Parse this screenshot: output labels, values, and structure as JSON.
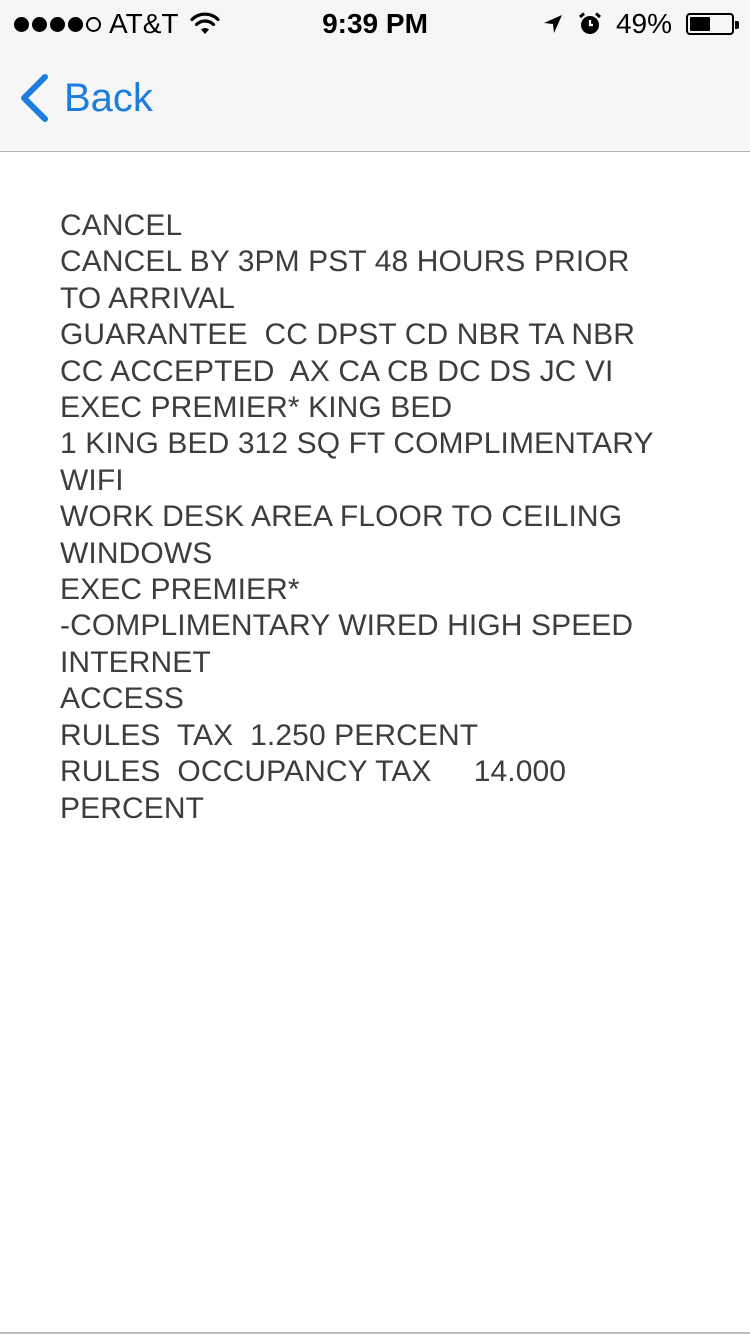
{
  "status_bar": {
    "carrier": "AT&T",
    "time": "9:39 PM",
    "battery_text": "49%",
    "battery_level": 0.49,
    "signal_dots_filled": 4,
    "signal_dots_total": 5,
    "icons": [
      "wifi-icon",
      "location-arrow-icon",
      "alarm-icon",
      "battery-icon"
    ]
  },
  "nav": {
    "back_label": "Back",
    "accent_color": "#1b7dde"
  },
  "details": {
    "lines": [
      "CANCEL",
      "CANCEL BY 3PM PST 48 HOURS PRIOR",
      "TO ARRIVAL",
      "GUARANTEE  CC DPST CD NBR TA NBR",
      "CC ACCEPTED  AX CA CB DC DS JC VI",
      "EXEC PREMIER* KING BED",
      "1 KING BED 312 SQ FT COMPLIMENTARY",
      "WIFI",
      "WORK DESK AREA FLOOR TO CEILING",
      "WINDOWS",
      "EXEC PREMIER*",
      "-COMPLIMENTARY WIRED HIGH SPEED",
      "INTERNET",
      "ACCESS",
      "RULES  TAX  1.250 PERCENT",
      "RULES  OCCUPANCY TAX     14.000",
      "PERCENT"
    ]
  }
}
